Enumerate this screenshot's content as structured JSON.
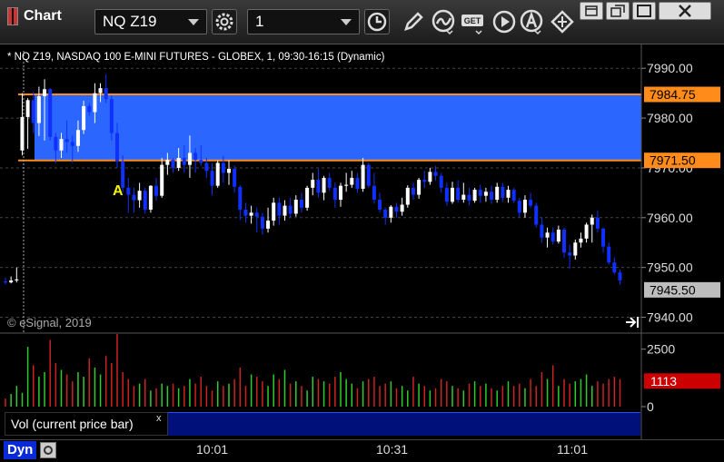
{
  "window": {
    "app_title": "Chart",
    "symbol": "NQ Z19",
    "interval": "1"
  },
  "chart_header": {
    "description": "* NQ Z19, NASDAQ 100 E-MINI FUTURES - GLOBEX, 1, 09:30-16:15 (Dynamic)",
    "watermark": "© eSignal, 2019"
  },
  "price_axis": {
    "ticks": [
      "7990.00",
      "7980.00",
      "7970.00",
      "7960.00",
      "7950.00",
      "7940.00"
    ],
    "range": [
      7937,
      7993.5
    ]
  },
  "levels": {
    "upper": "7984.75",
    "lower": "7971.50",
    "last": "7945.50",
    "upper_value": 7984.75,
    "lower_value": 7971.5,
    "last_value": 7945.5,
    "line_color": "#ff8c1a",
    "zone_color": "#2a66ff"
  },
  "annotation": {
    "label": "A",
    "color": "#f4f400"
  },
  "volume": {
    "panel_label": "Vol (current price bar)",
    "close_glyph": "x",
    "ticks": [
      "2500",
      "0"
    ],
    "current": "1113",
    "current_color": "#cc0000",
    "max": 3000
  },
  "time_axis": {
    "labels": [
      "10:01",
      "10:31",
      "11:01"
    ]
  },
  "bottom": {
    "dyn_label": "Dyn"
  },
  "colors": {
    "up": "#ffffff",
    "down": "#1030ff",
    "vol_up": "#2ecc2e",
    "vol_down": "#cc2222"
  },
  "chart_data": {
    "type": "candlestick",
    "x_start": "09:30",
    "interval_minutes": 1,
    "candles": [
      [
        7947.2,
        7948.0,
        7946.6,
        7947.0
      ],
      [
        7947.0,
        7948.2,
        7946.8,
        7947.4
      ],
      [
        7947.4,
        7950.0,
        7947.0,
        7947.6
      ],
      [
        7973.5,
        7985.0,
        7972.5,
        7980.2
      ],
      [
        7980.2,
        7984.0,
        7973.8,
        7983.6
      ],
      [
        7983.6,
        7985.2,
        7977.0,
        7979.0
      ],
      [
        7979.0,
        7986.3,
        7976.4,
        7984.4
      ],
      [
        7984.4,
        7987.8,
        7975.5,
        7985.8
      ],
      [
        7985.8,
        7986.0,
        7975.5,
        7976.2
      ],
      [
        7976.2,
        7977.0,
        7971.0,
        7973.5
      ],
      [
        7973.5,
        7977.0,
        7972.0,
        7975.8
      ],
      [
        7975.8,
        7979.5,
        7973.0,
        7975.2
      ],
      [
        7975.2,
        7976.5,
        7971.0,
        7974.4
      ],
      [
        7974.4,
        7979.5,
        7973.2,
        7977.6
      ],
      [
        7977.6,
        7983.5,
        7976.8,
        7982.4
      ],
      [
        7982.4,
        7983.0,
        7980.5,
        7981.2
      ],
      [
        7981.2,
        7987.0,
        7979.0,
        7985.0
      ],
      [
        7985.0,
        7987.0,
        7983.2,
        7986.0
      ],
      [
        7986.0,
        7988.8,
        7983.0,
        7983.8
      ],
      [
        7983.8,
        7984.5,
        7975.5,
        7977.0
      ],
      [
        7977.0,
        7979.0,
        7970.0,
        7971.3
      ],
      [
        7971.3,
        7972.5,
        7965.0,
        7966.0
      ],
      [
        7966.0,
        7968.0,
        7961.0,
        7964.6
      ],
      [
        7964.6,
        7966.0,
        7961.0,
        7963.5
      ],
      [
        7963.5,
        7967.0,
        7962.0,
        7965.4
      ],
      [
        7965.4,
        7966.0,
        7960.8,
        7961.6
      ],
      [
        7961.6,
        7966.5,
        7961.0,
        7966.4
      ],
      [
        7966.4,
        7968.0,
        7963.4,
        7964.4
      ],
      [
        7964.4,
        7972.0,
        7964.0,
        7970.6
      ],
      [
        7970.6,
        7973.0,
        7968.6,
        7971.6
      ],
      [
        7971.6,
        7972.0,
        7969.0,
        7970.0
      ],
      [
        7970.0,
        7974.0,
        7969.4,
        7972.0
      ],
      [
        7972.0,
        7974.5,
        7969.0,
        7970.6
      ],
      [
        7970.6,
        7976.5,
        7968.0,
        7973.0
      ],
      [
        7973.0,
        7974.0,
        7969.0,
        7971.6
      ],
      [
        7971.6,
        7974.6,
        7970.4,
        7971.0
      ],
      [
        7971.0,
        7972.0,
        7968.0,
        7969.4
      ],
      [
        7969.4,
        7971.0,
        7964.5,
        7966.4
      ],
      [
        7966.4,
        7971.5,
        7966.0,
        7971.0
      ],
      [
        7971.0,
        7972.4,
        7967.0,
        7969.0
      ],
      [
        7969.0,
        7971.5,
        7966.6,
        7969.8
      ],
      [
        7969.8,
        7970.5,
        7965.0,
        7966.2
      ],
      [
        7966.2,
        7966.5,
        7959.5,
        7961.6
      ],
      [
        7961.6,
        7963.0,
        7959.0,
        7960.4
      ],
      [
        7960.4,
        7962.4,
        7958.8,
        7961.0
      ],
      [
        7961.0,
        7962.0,
        7957.0,
        7960.2
      ],
      [
        7960.2,
        7961.0,
        7956.6,
        7957.8
      ],
      [
        7957.8,
        7962.0,
        7957.0,
        7959.4
      ],
      [
        7959.4,
        7964.0,
        7958.4,
        7963.0
      ],
      [
        7963.0,
        7964.0,
        7958.6,
        7960.4
      ],
      [
        7960.4,
        7963.5,
        7959.4,
        7962.4
      ],
      [
        7962.4,
        7964.0,
        7960.0,
        7960.8
      ],
      [
        7960.8,
        7964.5,
        7960.2,
        7963.6
      ],
      [
        7963.6,
        7965.0,
        7961.0,
        7962.0
      ],
      [
        7962.0,
        7966.4,
        7961.4,
        7966.0
      ],
      [
        7966.0,
        7969.0,
        7964.5,
        7967.6
      ],
      [
        7967.6,
        7969.8,
        7964.0,
        7965.0
      ],
      [
        7965.0,
        7968.4,
        7963.5,
        7968.0
      ],
      [
        7968.0,
        7969.0,
        7965.4,
        7966.0
      ],
      [
        7966.0,
        7967.0,
        7962.0,
        7963.6
      ],
      [
        7963.6,
        7967.0,
        7962.2,
        7966.4
      ],
      [
        7966.4,
        7969.0,
        7965.2,
        7966.6
      ],
      [
        7966.6,
        7969.4,
        7966.0,
        7968.0
      ],
      [
        7968.0,
        7969.0,
        7965.0,
        7965.8
      ],
      [
        7965.8,
        7972.0,
        7965.2,
        7970.6
      ],
      [
        7970.6,
        7971.0,
        7966.0,
        7966.4
      ],
      [
        7966.4,
        7969.0,
        7962.8,
        7963.6
      ],
      [
        7963.6,
        7965.0,
        7961.0,
        7961.6
      ],
      [
        7961.6,
        7962.0,
        7958.6,
        7960.0
      ],
      [
        7960.0,
        7962.5,
        7959.0,
        7962.2
      ],
      [
        7962.2,
        7963.0,
        7960.0,
        7961.2
      ],
      [
        7961.2,
        7964.0,
        7960.4,
        7962.6
      ],
      [
        7962.6,
        7966.5,
        7962.0,
        7966.0
      ],
      [
        7966.0,
        7967.0,
        7963.6,
        7964.6
      ],
      [
        7964.6,
        7968.0,
        7963.8,
        7967.6
      ],
      [
        7967.6,
        7969.4,
        7966.0,
        7967.2
      ],
      [
        7967.2,
        7970.0,
        7966.6,
        7969.2
      ],
      [
        7969.2,
        7970.4,
        7967.4,
        7968.4
      ],
      [
        7968.4,
        7969.0,
        7965.0,
        7966.0
      ],
      [
        7966.0,
        7967.0,
        7962.4,
        7963.2
      ],
      [
        7963.2,
        7967.2,
        7962.8,
        7966.0
      ],
      [
        7966.0,
        7967.5,
        7963.0,
        7963.6
      ],
      [
        7963.6,
        7967.0,
        7963.0,
        7964.6
      ],
      [
        7964.6,
        7966.0,
        7962.4,
        7963.4
      ],
      [
        7963.4,
        7966.0,
        7963.0,
        7965.6
      ],
      [
        7965.6,
        7966.6,
        7963.0,
        7964.4
      ],
      [
        7964.4,
        7966.0,
        7963.2,
        7965.2
      ],
      [
        7965.2,
        7966.4,
        7962.8,
        7963.6
      ],
      [
        7963.6,
        7967.0,
        7963.0,
        7966.2
      ],
      [
        7966.2,
        7967.0,
        7963.2,
        7964.0
      ],
      [
        7964.0,
        7966.4,
        7963.0,
        7965.6
      ],
      [
        7965.6,
        7966.0,
        7963.0,
        7963.4
      ],
      [
        7963.4,
        7964.0,
        7960.0,
        7961.0
      ],
      [
        7961.0,
        7964.5,
        7960.0,
        7963.6
      ],
      [
        7963.6,
        7965.0,
        7962.0,
        7962.4
      ],
      [
        7962.4,
        7963.0,
        7958.0,
        7958.6
      ],
      [
        7958.6,
        7960.0,
        7955.0,
        7956.0
      ],
      [
        7956.0,
        7958.0,
        7954.0,
        7957.0
      ],
      [
        7957.0,
        7958.0,
        7954.6,
        7955.2
      ],
      [
        7955.2,
        7958.4,
        7954.8,
        7957.6
      ],
      [
        7957.6,
        7958.0,
        7952.0,
        7953.0
      ],
      [
        7953.0,
        7954.6,
        7949.8,
        7952.4
      ],
      [
        7952.4,
        7955.6,
        7951.6,
        7955.0
      ],
      [
        7955.0,
        7957.0,
        7954.0,
        7955.8
      ],
      [
        7955.8,
        7959.0,
        7955.0,
        7958.6
      ],
      [
        7958.6,
        7960.6,
        7955.0,
        7960.0
      ],
      [
        7960.0,
        7961.4,
        7957.0,
        7957.8
      ],
      [
        7957.8,
        7958.0,
        7953.0,
        7954.2
      ],
      [
        7954.2,
        7955.0,
        7950.6,
        7951.0
      ],
      [
        7951.0,
        7952.0,
        7948.6,
        7949.0
      ],
      [
        7949.0,
        7949.6,
        7946.6,
        7947.4
      ]
    ],
    "volume": [
      350,
      550,
      900,
      600,
      2600,
      1800,
      1300,
      1500,
      2900,
      1900,
      1600,
      1400,
      1100,
      1500,
      1300,
      2100,
      1700,
      1400,
      2200,
      1900,
      3300,
      1500,
      1200,
      900,
      1000,
      1200,
      700,
      800,
      1000,
      900,
      1000,
      800,
      900,
      1200,
      1000,
      1300,
      900,
      700,
      1100,
      900,
      1000,
      1200,
      1700,
      900,
      1400,
      1300,
      1100,
      900,
      1400,
      1200,
      1600,
      1000,
      1100,
      900,
      700,
      1300,
      1200,
      1100,
      1000,
      1300,
      1500,
      1200,
      1000,
      800,
      1100,
      1200,
      1300,
      900,
      1000,
      1100,
      800,
      900,
      700,
      1300,
      1000,
      900,
      700,
      800,
      1200,
      1100,
      900,
      800,
      700,
      1000,
      1100,
      900,
      1000,
      800,
      700,
      900,
      1100,
      900,
      1000,
      800,
      1200,
      900,
      1500,
      1200,
      1800,
      900,
      1200,
      1000,
      1100,
      1200,
      1400,
      900,
      1100,
      1000,
      1200,
      1300,
      1200
    ]
  }
}
